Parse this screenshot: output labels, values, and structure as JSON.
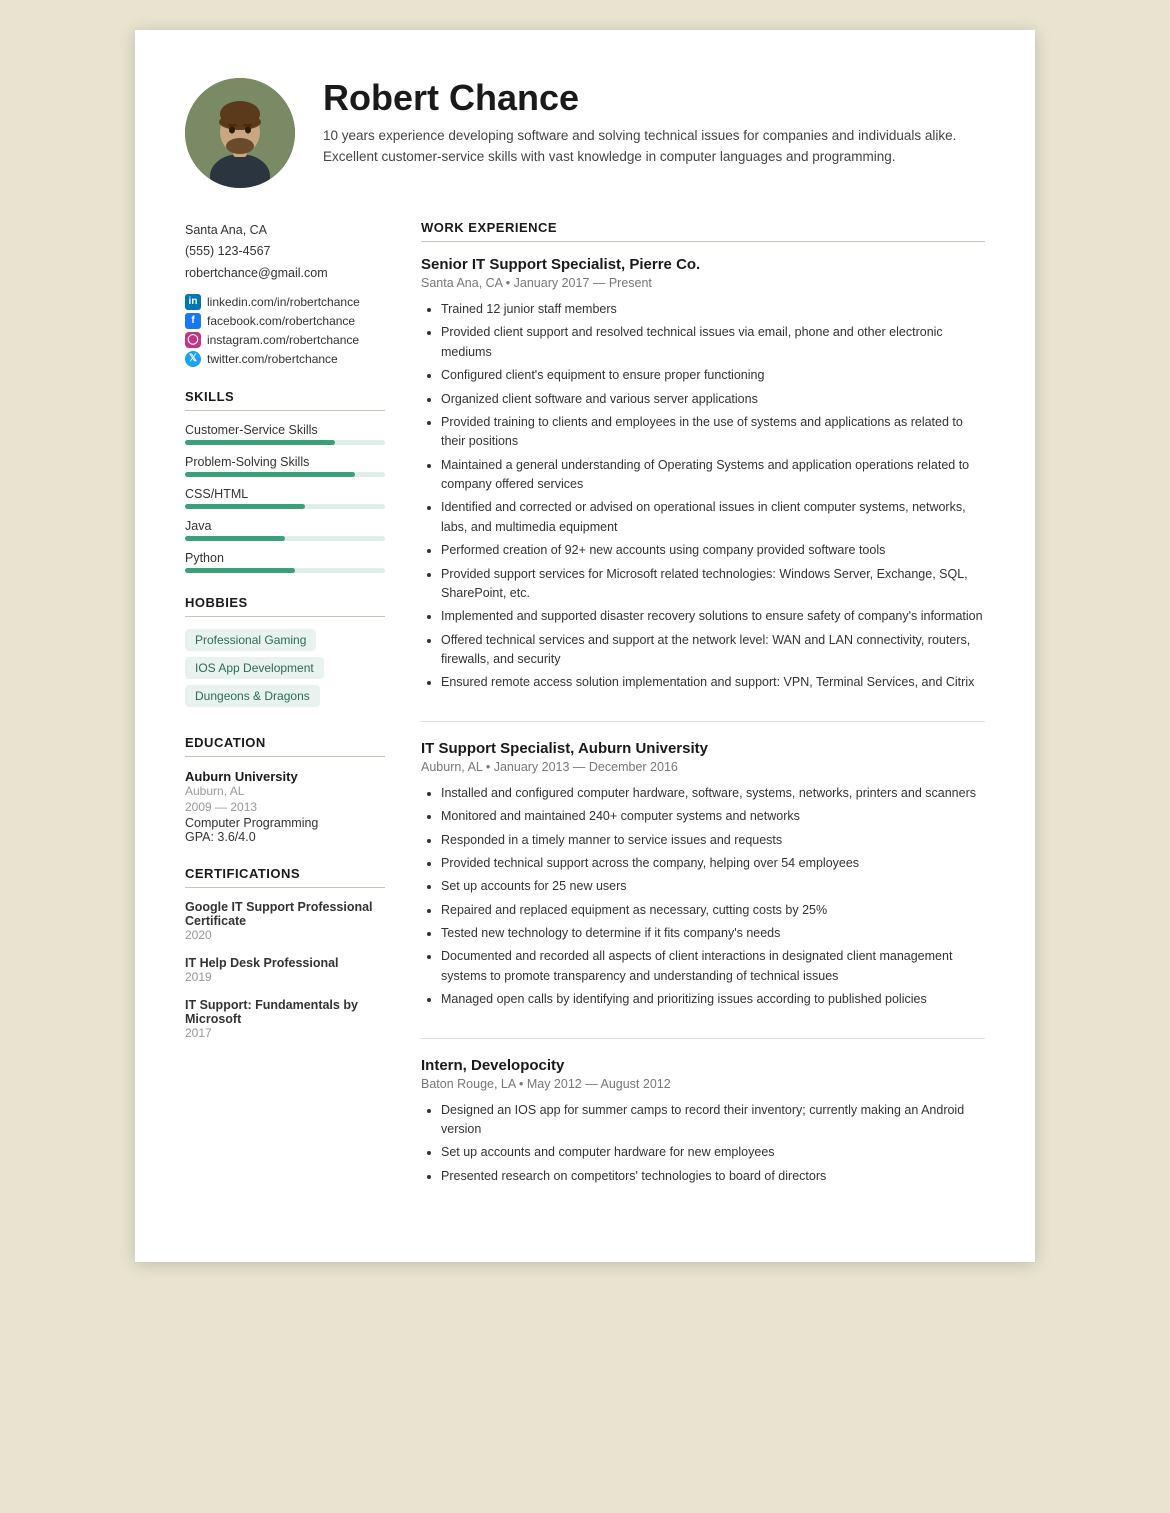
{
  "header": {
    "name": "Robert Chance",
    "summary": "10 years experience developing software and solving technical issues for companies and individuals alike. Excellent customer-service skills with vast knowledge in computer languages and programming."
  },
  "contact": {
    "location": "Santa Ana, CA",
    "phone": "(555) 123-4567",
    "email": "robertchance@gmail.com",
    "linkedin": "linkedin.com/in/robertchance",
    "facebook": "facebook.com/robertchance",
    "instagram": "instagram.com/robertchance",
    "twitter": "twitter.com/robertchance"
  },
  "skills": {
    "title": "SKILLS",
    "items": [
      {
        "name": "Customer-Service Skills",
        "pct": 75
      },
      {
        "name": "Problem-Solving Skills",
        "pct": 85
      },
      {
        "name": "CSS/HTML",
        "pct": 60
      },
      {
        "name": "Java",
        "pct": 50
      },
      {
        "name": "Python",
        "pct": 55
      }
    ]
  },
  "hobbies": {
    "title": "HOBBIES",
    "items": [
      "Professional Gaming",
      "IOS App Development",
      "Dungeons & Dragons"
    ]
  },
  "education": {
    "title": "EDUCATION",
    "items": [
      {
        "school": "Auburn University",
        "location": "Auburn, AL",
        "years": "2009 — 2013",
        "field": "Computer Programming",
        "gpa": "GPA: 3.6/4.0"
      }
    ]
  },
  "certifications": {
    "title": "CERTIFICATIONS",
    "items": [
      {
        "name": "Google IT Support Professional Certificate",
        "year": "2020"
      },
      {
        "name": "IT Help Desk Professional",
        "year": "2019"
      },
      {
        "name": "IT Support: Fundamentals by Microsoft",
        "year": "2017"
      }
    ]
  },
  "work_experience": {
    "title": "WORK EXPERIENCE",
    "jobs": [
      {
        "title": "Senior IT Support Specialist, Pierre Co.",
        "meta": "Santa Ana, CA • January 2017 — Present",
        "bullets": [
          "Trained 12 junior staff members",
          "Provided client support and resolved technical issues via email, phone and other electronic mediums",
          "Configured client's equipment to ensure proper functioning",
          "Organized client software and various server applications",
          "Provided training to clients and employees in the use of systems and applications as related to their positions",
          "Maintained a general understanding of Operating Systems and application operations related to company offered services",
          "Identified and corrected or advised on operational issues in client computer systems, networks, labs, and multimedia equipment",
          "Performed creation of 92+ new accounts using company provided software tools",
          "Provided support services for Microsoft related technologies: Windows Server, Exchange, SQL, SharePoint, etc.",
          "Implemented and supported disaster recovery solutions to ensure safety of company's information",
          "Offered technical services and support at the network level: WAN and LAN connectivity, routers, firewalls, and security",
          "Ensured remote access solution implementation and support: VPN, Terminal Services, and Citrix"
        ]
      },
      {
        "title": "IT Support Specialist, Auburn University",
        "meta": "Auburn, AL • January 2013 — December 2016",
        "bullets": [
          "Installed and configured computer hardware, software, systems, networks, printers and scanners",
          "Monitored and maintained 240+ computer systems and networks",
          "Responded in a timely manner to service issues and requests",
          "Provided technical support across the company, helping over 54 employees",
          "Set up accounts for 25 new users",
          "Repaired and replaced equipment as necessary, cutting costs by 25%",
          "Tested new technology to determine if it fits company's needs",
          "Documented and recorded all aspects of client interactions in designated client management systems to promote transparency and understanding of technical issues",
          "Managed open calls by identifying and prioritizing issues according to published policies"
        ]
      },
      {
        "title": "Intern, Developocity",
        "meta": "Baton Rouge, LA • May 2012 — August 2012",
        "bullets": [
          "Designed an IOS app for summer camps to record their inventory; currently making an Android version",
          "Set up accounts and computer hardware for new employees",
          "Presented research on competitors' technologies to board of directors"
        ]
      }
    ]
  }
}
